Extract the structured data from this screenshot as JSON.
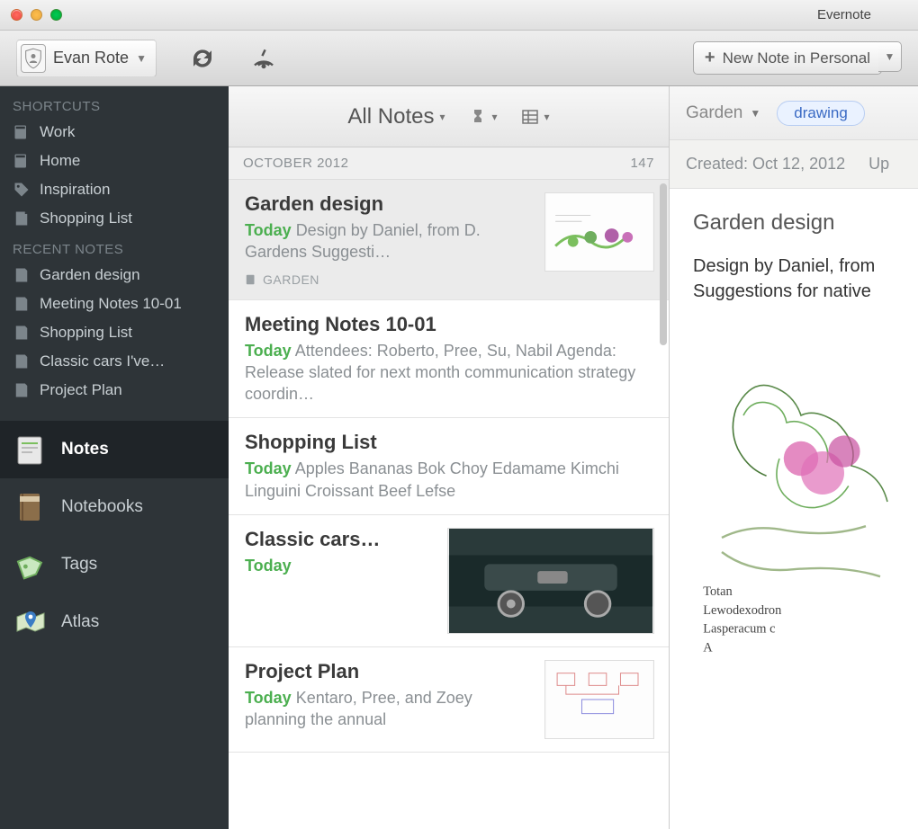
{
  "app": {
    "title": "Evernote"
  },
  "toolbar": {
    "account_name": "Evan Rote",
    "new_note_label": "New Note in Personal"
  },
  "sidebar": {
    "shortcuts_header": "SHORTCUTS",
    "shortcuts": [
      {
        "label": "Work",
        "icon": "notebook-icon"
      },
      {
        "label": "Home",
        "icon": "notebook-icon"
      },
      {
        "label": "Inspiration",
        "icon": "tag-icon"
      },
      {
        "label": "Shopping List",
        "icon": "note-icon"
      }
    ],
    "recent_header": "RECENT NOTES",
    "recent": [
      {
        "label": "Garden design"
      },
      {
        "label": "Meeting Notes 10-01"
      },
      {
        "label": "Shopping List"
      },
      {
        "label": "Classic cars I've…"
      },
      {
        "label": "Project Plan"
      }
    ],
    "nav": [
      {
        "label": "Notes",
        "icon": "notes-nav-icon",
        "active": true
      },
      {
        "label": "Notebooks",
        "icon": "notebook-nav-icon",
        "active": false
      },
      {
        "label": "Tags",
        "icon": "tag-nav-icon",
        "active": false
      },
      {
        "label": "Atlas",
        "icon": "map-nav-icon",
        "active": false
      }
    ]
  },
  "list": {
    "header_label": "All Notes",
    "date_group": "OCTOBER 2012",
    "group_count": "147",
    "notes": [
      {
        "title": "Garden design",
        "date_label": "Today",
        "snippet": "Design by Daniel, from D. Gardens Suggesti…",
        "tag": "GARDEN",
        "thumb": "garden",
        "selected": true
      },
      {
        "title": "Meeting Notes 10-01",
        "date_label": "Today",
        "snippet": "Attendees: Roberto, Pree, Su, Nabil Agenda: Release slated for next month communication strategy coordin…",
        "selected": false
      },
      {
        "title": "Shopping List",
        "date_label": "Today",
        "snippet": "Apples Bananas Bok Choy Edamame Kimchi Linguini Croissant Beef Lefse",
        "selected": false
      },
      {
        "title": "Classic cars…",
        "date_label": "Today",
        "snippet": "",
        "thumb": "car",
        "selected": false
      },
      {
        "title": "Project Plan",
        "date_label": "Today",
        "snippet": "Kentaro, Pree, and Zoey planning the annual",
        "thumb": "plan",
        "selected": false
      }
    ]
  },
  "detail": {
    "notebook_label": "Garden",
    "tag_pill": "drawing",
    "created_label": "Created: Oct 12, 2012",
    "updated_label_prefix": "Up",
    "title": "Garden design",
    "body_line1": "Design by Daniel, from",
    "body_line2": "Suggestions for native",
    "sketch_caption_1": "Totan",
    "sketch_caption_2": "Lewodexodron",
    "sketch_caption_3": "Lasperacum c",
    "sketch_caption_4": "A"
  }
}
